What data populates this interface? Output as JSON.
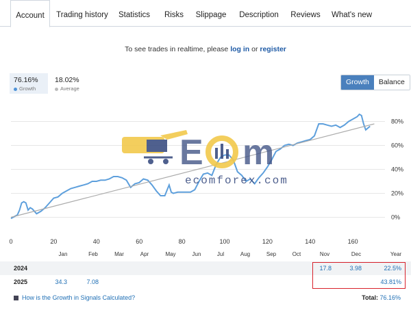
{
  "tabs": [
    {
      "label": "Account",
      "active": true
    },
    {
      "label": "Trading history"
    },
    {
      "label": "Statistics"
    },
    {
      "label": "Risks"
    },
    {
      "label": "Slippage"
    },
    {
      "label": "Description"
    },
    {
      "label": "Reviews"
    },
    {
      "label": "What's new"
    }
  ],
  "realtime": {
    "prefix": "To see trades in realtime, please",
    "login": "log in",
    "or": "or",
    "register": "register"
  },
  "stats": {
    "growth": {
      "value": "76.16%",
      "label": "Growth",
      "color": "#4f93d8"
    },
    "average": {
      "value": "18.02%",
      "label": "Average",
      "color": "#bbbbbb"
    }
  },
  "toggle": {
    "growth": "Growth",
    "balance": "Balance"
  },
  "watermark": {
    "brand": "ecomforex.com"
  },
  "chart_data": {
    "type": "line",
    "x_ticks": [
      "0",
      "20",
      "40",
      "60",
      "80",
      "100",
      "120",
      "140",
      "160"
    ],
    "y_ticks": [
      "0%",
      "20%",
      "40%",
      "60%",
      "80%"
    ],
    "xlim": [
      0,
      175
    ],
    "ylim": [
      -10,
      90
    ],
    "month_labels": [
      "Jan",
      "Feb",
      "Mar",
      "Apr",
      "May",
      "Jun",
      "Jul",
      "Aug",
      "Sep",
      "Oct",
      "Nov",
      "Dec",
      "Year"
    ],
    "series": [
      {
        "color": "#5d9fdc",
        "x": [
          0,
          3,
          4,
          5,
          6,
          7,
          8,
          9,
          10,
          11,
          12,
          14,
          16,
          18,
          20,
          22,
          24,
          26,
          28,
          30,
          32,
          34,
          36,
          38,
          40,
          42,
          44,
          46,
          48,
          50,
          52,
          54,
          56,
          58,
          60,
          62,
          64,
          66,
          68,
          70,
          72,
          74,
          75,
          76,
          78,
          80,
          82,
          84,
          86,
          88,
          90,
          92,
          94,
          96,
          98,
          100,
          102,
          104,
          106,
          108,
          110,
          112,
          114,
          116,
          118,
          120,
          122,
          124,
          126,
          128,
          130,
          132,
          134,
          136,
          138,
          140,
          142,
          144,
          146,
          148,
          150,
          152,
          154,
          156,
          158,
          160,
          162,
          163,
          164,
          165,
          166,
          168
        ],
        "y": [
          -1,
          2,
          6,
          12,
          13,
          12,
          6,
          8,
          7,
          5,
          3,
          5,
          8,
          12,
          16,
          17,
          20,
          22,
          24,
          25,
          26,
          27,
          28,
          30,
          30,
          31,
          31,
          32,
          34,
          34,
          33,
          31,
          25,
          28,
          29,
          32,
          31,
          27,
          22,
          18,
          18,
          27,
          21,
          20,
          21,
          21,
          21,
          21,
          23,
          30,
          36,
          37,
          35,
          44,
          50,
          52,
          52,
          48,
          38,
          35,
          30,
          32,
          28,
          33,
          37,
          42,
          48,
          55,
          57,
          60,
          61,
          60,
          62,
          63,
          64,
          65,
          68,
          78,
          78,
          77,
          76,
          77,
          75,
          77,
          80,
          82,
          84,
          86,
          85,
          78,
          73,
          76
        ]
      },
      {
        "color": "#aaaaaa",
        "x": [
          0,
          170
        ],
        "y": [
          0,
          78
        ]
      }
    ]
  },
  "table": {
    "rows": [
      {
        "year": "2024",
        "cells": [
          {
            "col": 10,
            "v": "17.8"
          },
          {
            "col": 11,
            "v": "3.98"
          },
          {
            "col": 12,
            "v": "22.5%"
          }
        ]
      },
      {
        "year": "2025",
        "cells": [
          {
            "col": 0,
            "v": "34.3"
          },
          {
            "col": 1,
            "v": "7.08"
          },
          {
            "col": 12,
            "v": "43.81%"
          }
        ]
      }
    ]
  },
  "footer": {
    "question": "How is the Growth in Signals Calculated?",
    "total_label": "Total:",
    "total_value": "76.16%"
  }
}
